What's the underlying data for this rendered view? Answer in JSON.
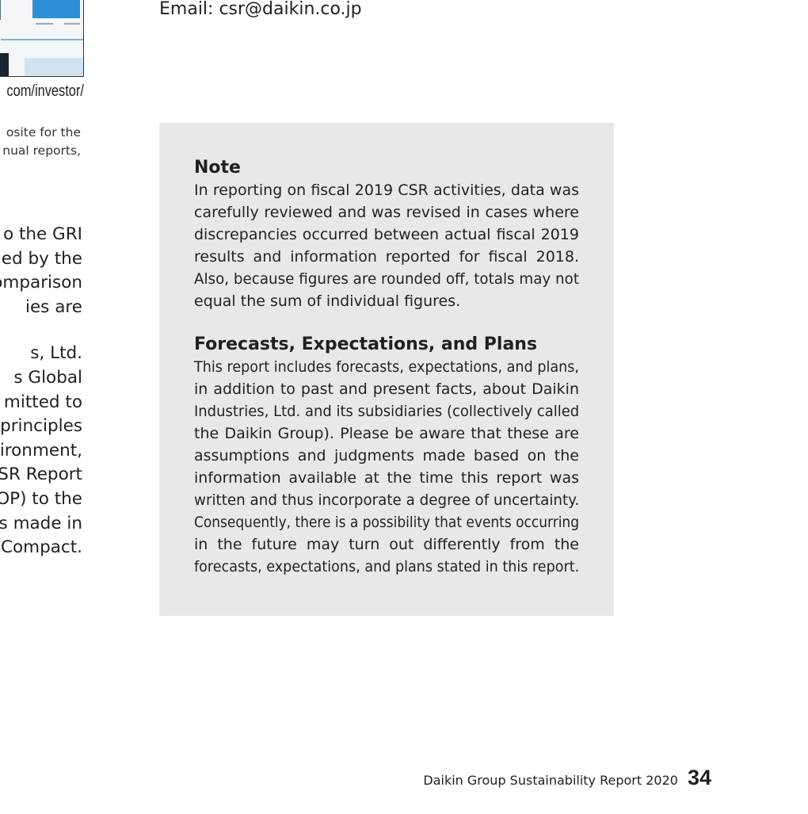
{
  "left_column": {
    "url_fragment": "com/investor/",
    "small_lines": [
      "osite for the",
      "nual reports,"
    ],
    "big_lines_1": [
      "o the GRI",
      "ed by the",
      "omparison",
      "ies are"
    ],
    "big_lines_2": [
      "s, Ltd.",
      "s Global",
      "mitted to",
      "principles",
      "vironment,",
      "SR Report",
      "OP) to the",
      "ss made in",
      "Compact."
    ]
  },
  "contact": {
    "email": "Email: csr@daikin.co.jp"
  },
  "note": {
    "title": "Note",
    "lines": [
      "In reporting on fiscal 2019 CSR activities, data was",
      "carefully reviewed and was revised in cases where",
      "discrepancies occurred between actual fiscal 2019",
      "results and information reported for fiscal 2018.",
      "Also, because figures are rounded off, totals may not",
      "equal the sum of individual figures."
    ]
  },
  "forecasts": {
    "title": "Forecasts, Expectations, and Plans",
    "lines": [
      "This report includes forecasts, expectations, and plans,",
      "in addition to past and present facts, about Daikin",
      "Industries, Ltd. and its subsidiaries (collectively called",
      "the Daikin Group). Please be aware that these are",
      "assumptions and judgments made based on the",
      "information available at the time this report was",
      "written and thus incorporate a degree of uncertainty.",
      "Consequently, there is a possibility that events occurring",
      "in the future may turn out differently from the",
      "forecasts, expectations, and plans stated in this report."
    ]
  },
  "footer": {
    "report_title": "Daikin Group Sustainability Report 2020",
    "page_number": "34"
  }
}
